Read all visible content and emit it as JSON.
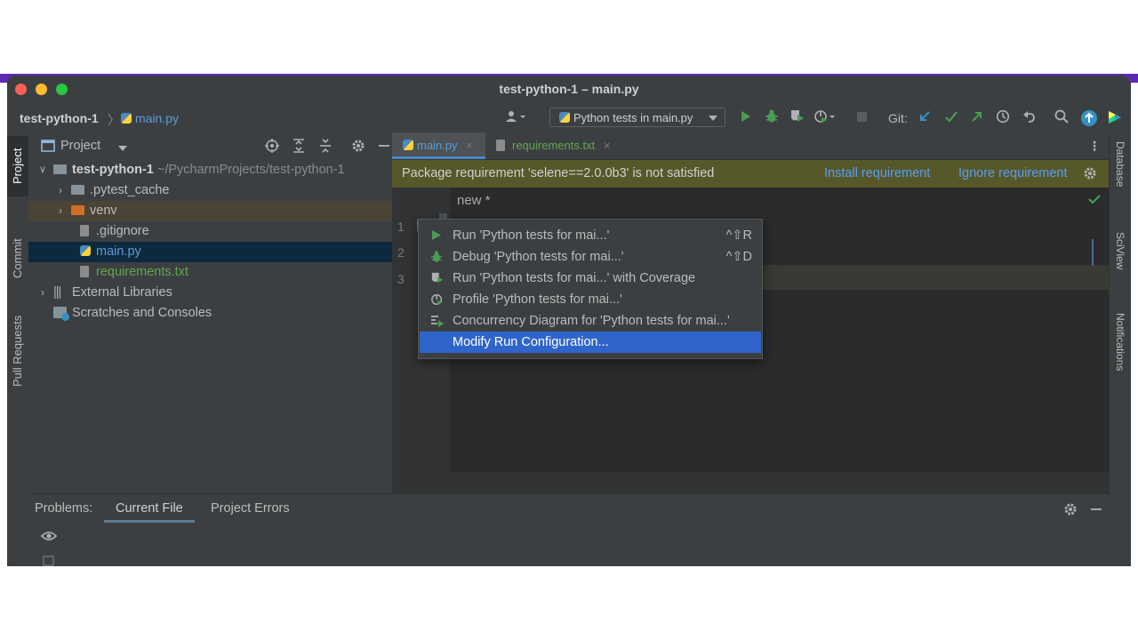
{
  "window": {
    "title": "test-python-1 – main.py"
  },
  "navbar": {
    "project": "test-python-1",
    "separator": "〉",
    "file": "main.py",
    "run_config": "Python tests in main.py",
    "git_label": "Git:"
  },
  "left_tabs": {
    "project": "Project",
    "commit": "Commit",
    "pull_requests": "Pull Requests"
  },
  "right_tabs": {
    "database": "Database",
    "sciview": "SciView",
    "notifications": "Notifications"
  },
  "project_panel": {
    "title": "Project",
    "tree": [
      {
        "label": "test-python-1",
        "path": "~/PycharmProjects/test-python-1"
      },
      {
        "label": ".pytest_cache"
      },
      {
        "label": "venv"
      },
      {
        "label": ".gitignore"
      },
      {
        "label": "main.py"
      },
      {
        "label": "requirements.txt"
      },
      {
        "label": "External Libraries"
      },
      {
        "label": "Scratches and Consoles"
      }
    ]
  },
  "editor": {
    "tabs": [
      {
        "label": "main.py"
      },
      {
        "label": "requirements.txt"
      }
    ],
    "close_glyph": "×",
    "banner": {
      "message": "Package requirement 'selene==2.0.0b3' is not satisfied",
      "install": "Install requirement",
      "ignore": "Ignore requirement"
    },
    "inlay_hint": "new *",
    "line_numbers": [
      "1",
      "2",
      "3"
    ]
  },
  "popup": {
    "items": [
      {
        "label": "Run 'Python tests for mai...'",
        "shortcut": "^⇧R",
        "icon": "run-icon"
      },
      {
        "label": "Debug 'Python tests for mai...'",
        "shortcut": "^⇧D",
        "icon": "debug-icon"
      },
      {
        "label": "Run 'Python tests for mai...' with Coverage",
        "shortcut": "",
        "icon": "coverage-icon"
      },
      {
        "label": "Profile 'Python tests for mai...'",
        "shortcut": "",
        "icon": "profile-icon"
      },
      {
        "label": "Concurrency Diagram for 'Python tests for mai...'",
        "shortcut": "",
        "icon": "concurrency-icon"
      },
      {
        "label": "Modify Run Configuration...",
        "shortcut": "",
        "icon": ""
      }
    ]
  },
  "bottom_panel": {
    "problems_label": "Problems:",
    "tabs": [
      {
        "label": "Current File"
      },
      {
        "label": "Project Errors"
      }
    ]
  },
  "colors": {
    "accent_blue": "#2f65ca",
    "run_green": "#499c54",
    "link_blue": "#589df6",
    "warning_banner": "#57582a"
  }
}
